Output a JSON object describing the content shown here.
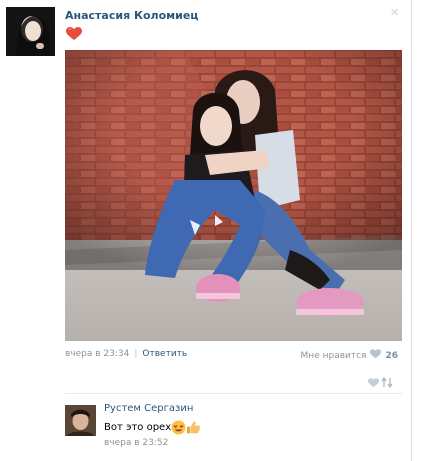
{
  "post": {
    "author": "Анастасия Коломиец",
    "close_label": "✕",
    "timestamp": "вчера в 23:34",
    "reply_label": "Ответить",
    "likes_label": "Мне нравится",
    "likes_count": "26",
    "heart_color": "#e74c3c"
  },
  "comment": {
    "author": "Рустем Сергазин",
    "text": "Вот это орех",
    "timestamp": "вчера в 23:52",
    "emojis": [
      "heart-eyes-emoji",
      "thumbs-up-emoji"
    ]
  },
  "colors": {
    "link": "#2b587a",
    "meta": "#939393",
    "icon": "#b8c3cf"
  }
}
